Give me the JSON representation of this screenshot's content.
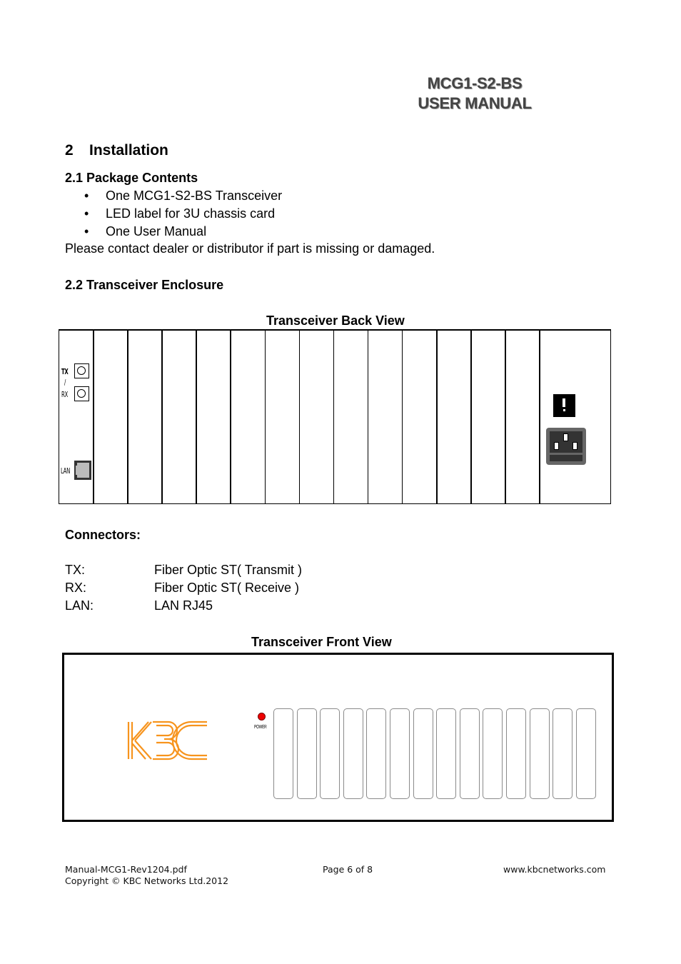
{
  "header": {
    "title_line1": "MCG1-S2-BS",
    "title_line2": "USER MANUAL"
  },
  "section2": {
    "number": "2",
    "title": "Installation",
    "sub1": {
      "heading": "2.1 Package Contents",
      "items": [
        "One MCG1-S2-BS Transceiver",
        "LED label for 3U chassis card",
        "One User Manual"
      ],
      "note": "Please contact dealer or distributor if part is missing or damaged."
    },
    "sub2": {
      "heading": "2.2 Transceiver Enclosure"
    }
  },
  "back_view": {
    "caption": "Transceiver Back View",
    "labels": {
      "tx": "TX",
      "slash": "/",
      "rx": "RX",
      "lan": "LAN"
    },
    "slot_count": 14,
    "icons": {
      "warning": "warning-icon",
      "power_inlet": "iec-power-inlet-icon"
    }
  },
  "connectors": {
    "heading": "Connectors:",
    "rows": [
      {
        "key": "TX:",
        "value": "Fiber Optic ST( Transmit )"
      },
      {
        "key": "RX:",
        "value": "Fiber Optic ST( Receive )"
      },
      {
        "key": "LAN:",
        "value": "LAN RJ45"
      }
    ]
  },
  "front_view": {
    "caption": "Transceiver Front View",
    "logo_text": "KBC",
    "power_label": "POWER",
    "slot_count": 14,
    "colors": {
      "logo": "#f7941d",
      "power_led": "#e00000"
    }
  },
  "footer": {
    "filename": "Manual-MCG1-Rev1204.pdf",
    "copyright": "Copyright © KBC Networks Ltd.2012",
    "page": "Page 6 of 8",
    "website": "www.kbcnetworks.com"
  }
}
